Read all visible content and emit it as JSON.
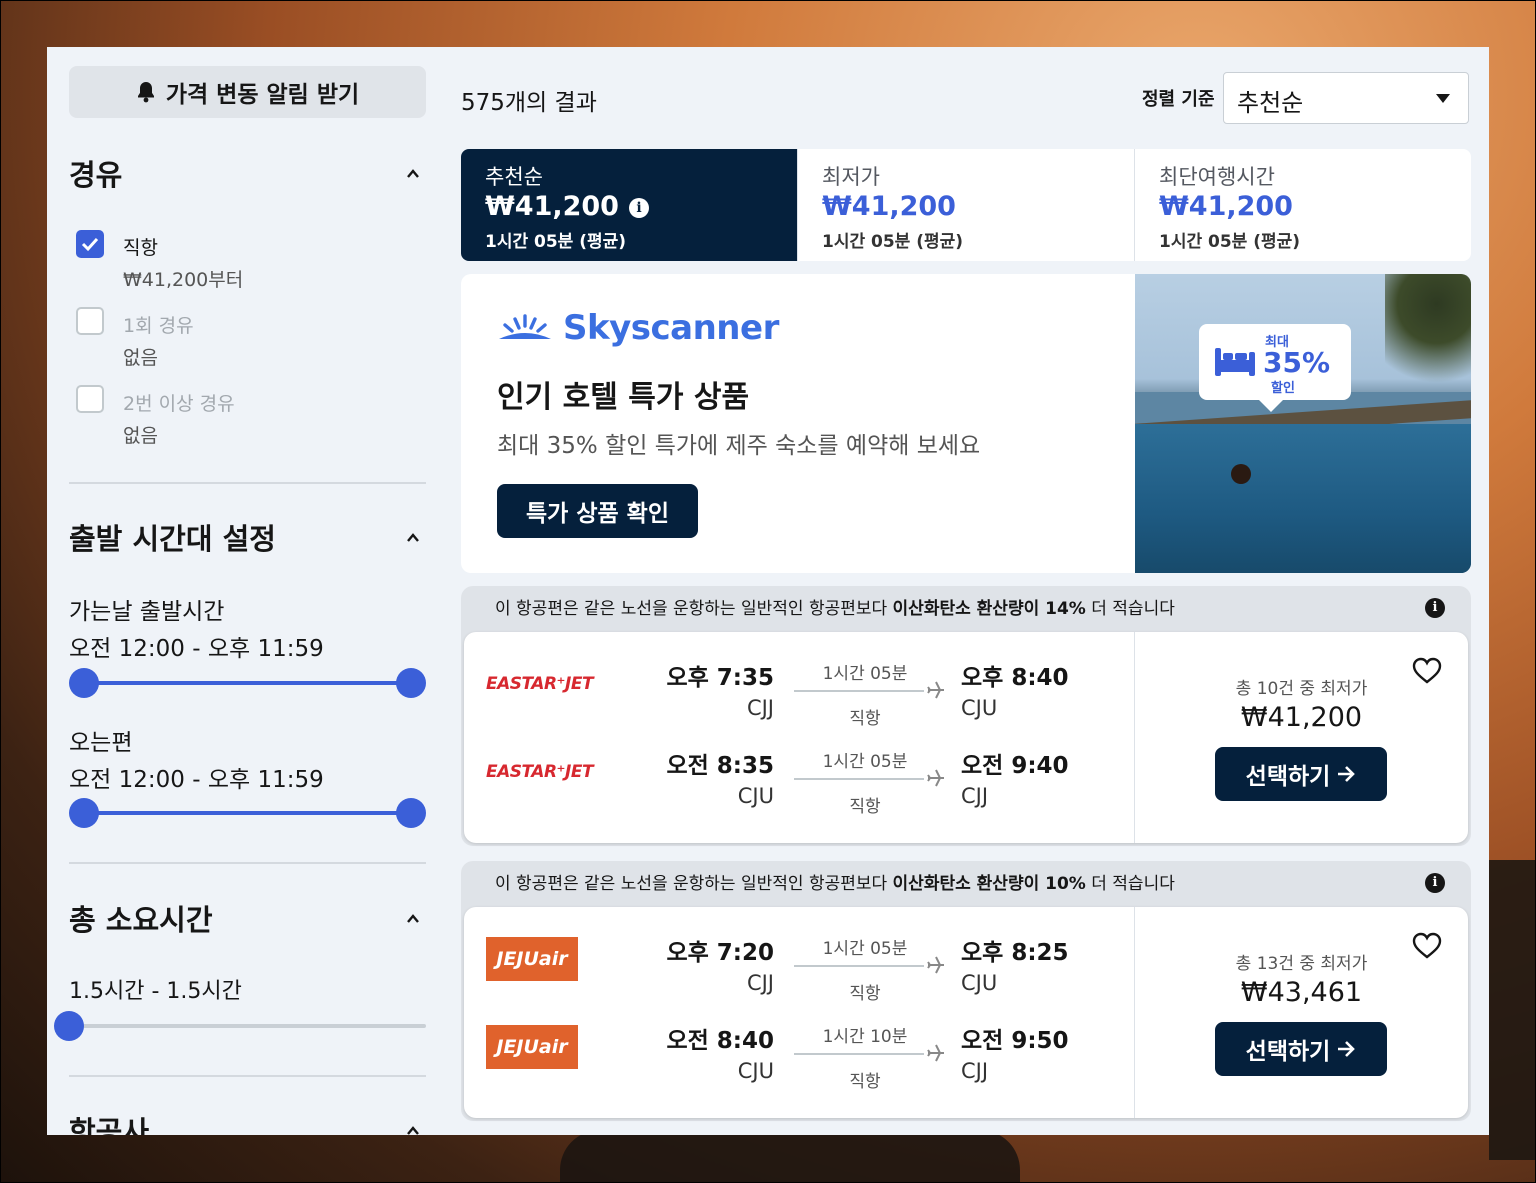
{
  "sidebar": {
    "alert_button": "가격 변동 알림 받기",
    "stops": {
      "title": "경유",
      "options": [
        {
          "label": "직항",
          "sub": "₩41,200부터",
          "checked": true
        },
        {
          "label": "1회 경유",
          "sub": "없음",
          "checked": false
        },
        {
          "label": "2번 이상 경유",
          "sub": "없음",
          "checked": false
        }
      ]
    },
    "departure": {
      "title": "출발 시간대 설정",
      "outbound_label": "가는날 출발시간",
      "outbound_range": "오전 12:00 - 오후 11:59",
      "return_label": "오는편",
      "return_range": "오전 12:00 - 오후 11:59"
    },
    "duration": {
      "title": "총 소요시간",
      "range": "1.5시간 - 1.5시간"
    },
    "airlines": {
      "title": "항공사"
    }
  },
  "results": {
    "count": "575개의 결과",
    "sort_label": "정렬 기준",
    "sort_value": "추천순"
  },
  "tabs": [
    {
      "name": "추천순",
      "price": "₩41,200",
      "duration": "1시간 05분 (평균)",
      "active": true
    },
    {
      "name": "최저가",
      "price": "₩41,200",
      "duration": "1시간 05분 (평균)",
      "active": false
    },
    {
      "name": "최단여행시간",
      "price": "₩41,200",
      "duration": "1시간 05분 (평균)",
      "active": false
    }
  ],
  "ad": {
    "brand": "Skyscanner",
    "headline": "인기 호텔 특가 상품",
    "subtext": "최대 35% 할인 특가에 제주 숙소를 예약해 보세요",
    "cta": "특가 상품 확인",
    "badge_top": "최대",
    "badge_big": "35%",
    "badge_bottom": "할인"
  },
  "flights": [
    {
      "eco_pre": "이 항공편은 같은 노선을 운항하는 일반적인 항공편보다 ",
      "eco_bold": "이산화탄소 환산량이",
      "eco_pct": " 14%",
      "eco_post": " 더 적습니다",
      "airline_logo": "EASTAR⁺JET",
      "legs": [
        {
          "dep_time": "오후 7:35",
          "dep_code": "CJJ",
          "duration": "1시간 05분",
          "stops": "직항",
          "arr_time": "오후 8:40",
          "arr_code": "CJU"
        },
        {
          "dep_time": "오전 8:35",
          "dep_code": "CJU",
          "duration": "1시간 05분",
          "stops": "직항",
          "arr_time": "오전 9:40",
          "arr_code": "CJJ"
        }
      ],
      "cheapest_note": "총 10건 중 최저가",
      "price": "₩41,200",
      "select": "선택하기"
    },
    {
      "eco_pre": "이 항공편은 같은 노선을 운항하는 일반적인 항공편보다 ",
      "eco_bold": "이산화탄소 환산량이",
      "eco_pct": " 10%",
      "eco_post": " 더 적습니다",
      "airline_logo": "JEJUair",
      "legs": [
        {
          "dep_time": "오후 7:20",
          "dep_code": "CJJ",
          "duration": "1시간 05분",
          "stops": "직항",
          "arr_time": "오후 8:25",
          "arr_code": "CJU"
        },
        {
          "dep_time": "오전 8:40",
          "dep_code": "CJU",
          "duration": "1시간 10분",
          "stops": "직항",
          "arr_time": "오전 9:50",
          "arr_code": "CJJ"
        }
      ],
      "cheapest_note": "총 13건 중 최저가",
      "price": "₩43,461",
      "select": "선택하기"
    }
  ],
  "colors": {
    "accent": "#3b5fd8",
    "dark_navy": "#05203c",
    "panel_bg": "#eff3f8"
  }
}
